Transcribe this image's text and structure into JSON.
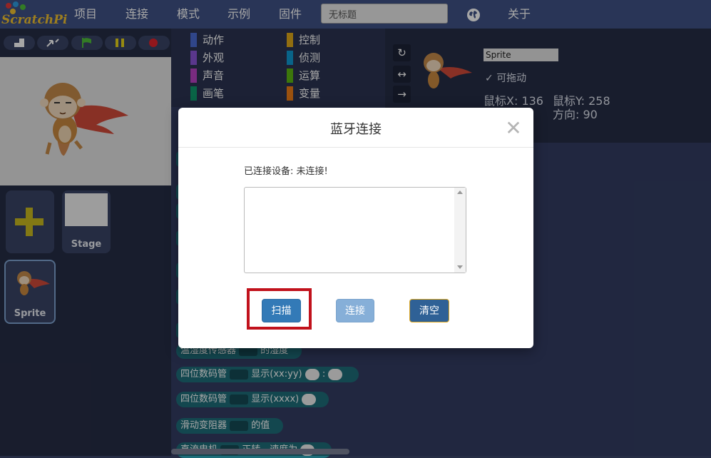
{
  "app": {
    "logo_text": "ScratchPi"
  },
  "menu": {
    "items": [
      "项目",
      "连接",
      "模式",
      "示例",
      "固件"
    ],
    "title_value": "无标题",
    "about_label": "关于"
  },
  "stage": {
    "tiles": {
      "stage_label": "Stage",
      "sprite_label": "Sprite"
    }
  },
  "palette": {
    "categories": [
      {
        "label": "动作",
        "color": "#4a6cd4"
      },
      {
        "label": "控制",
        "color": "#e1a91a"
      },
      {
        "label": "外观",
        "color": "#8a55d7"
      },
      {
        "label": "侦测",
        "color": "#0e9ad3"
      },
      {
        "label": "声音",
        "color": "#bb42c3"
      },
      {
        "label": "运算",
        "color": "#5cb712"
      },
      {
        "label": "画笔",
        "color": "#0e9a6c"
      },
      {
        "label": "变量",
        "color": "#ee7d16"
      }
    ],
    "blocks": [
      {
        "pre": "温湿度传感器",
        "post": "的湿度"
      },
      {
        "pre": "四位数码管",
        "post": "显示(xx:yy)",
        "sep": ":"
      },
      {
        "pre": "四位数码管",
        "post": "显示(xxxx)"
      },
      {
        "pre": "滑动变阻器",
        "post": "的值"
      },
      {
        "pre": "直流电机",
        "post": "正转，速度为"
      }
    ]
  },
  "sprite_info": {
    "name_value": "Sprite",
    "draggable_label": "可拖动",
    "mouse_x_label": "鼠标X: 136",
    "mouse_y_label": "鼠标Y: 258",
    "direction_label": "方向: 90",
    "rotation_buttons": [
      "↻",
      "↔",
      "→"
    ]
  },
  "modal": {
    "title": "蓝牙连接",
    "close_glyph": "✕",
    "device_status": "已连接设备:   未连接!",
    "device_list_value": "",
    "buttons": {
      "scan": "扫描",
      "connect": "连接",
      "clear": "清空"
    },
    "colors": {
      "scan": "#337ab7",
      "connect": "#86afd8",
      "clear": "#2f6196",
      "highlight": "#c1121c"
    }
  }
}
